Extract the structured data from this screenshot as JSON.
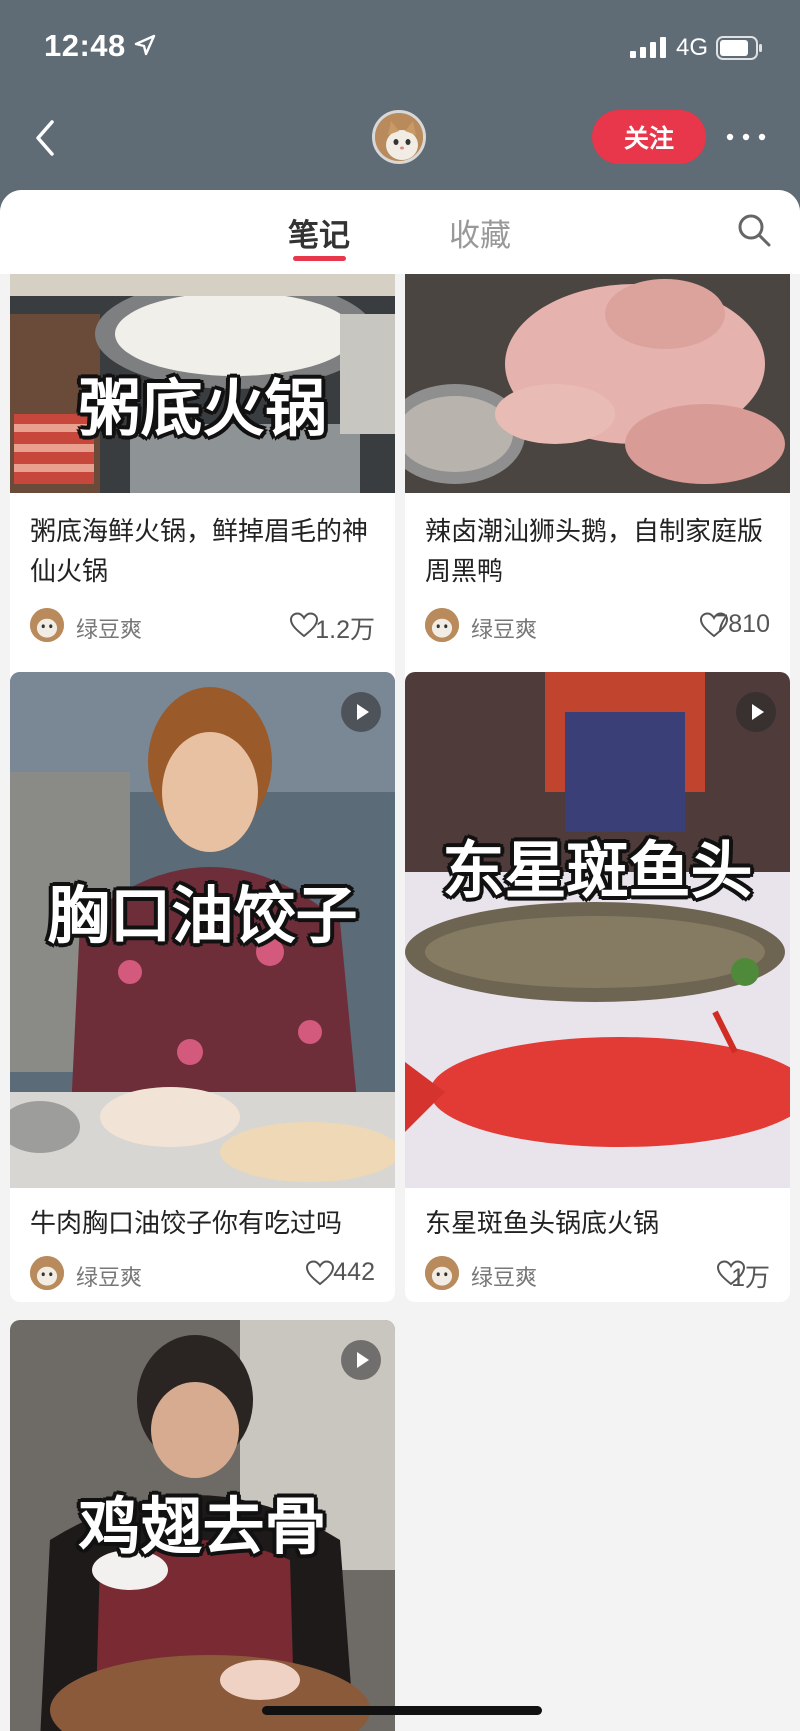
{
  "status_bar": {
    "time": "12:48",
    "network": "4G"
  },
  "header": {
    "follow_label": "关注"
  },
  "tabs": [
    {
      "label": "笔记"
    },
    {
      "label": "收藏"
    }
  ],
  "notes": [
    {
      "overlay": "粥底火锅",
      "title": "粥底海鲜火锅，鲜掉眉毛的神仙火锅",
      "author": "绿豆爽",
      "likes": "1.2万",
      "video": false
    },
    {
      "overlay": "",
      "title": "辣卤潮汕狮头鹅，自制家庭版周黑鸭",
      "author": "绿豆爽",
      "likes": "7810",
      "video": false
    },
    {
      "overlay": "胸口油饺子",
      "title": "牛肉胸口油饺子你有吃过吗",
      "author": "绿豆爽",
      "likes": "442",
      "video": true
    },
    {
      "overlay": "东星斑鱼头",
      "title": "东星斑鱼头锅底火锅",
      "author": "绿豆爽",
      "likes": "1万",
      "video": true
    },
    {
      "overlay": "鸡翅去骨",
      "title": "",
      "author": "",
      "likes": "",
      "video": true
    }
  ],
  "colors": {
    "accent": "#e8364a",
    "header_bg": "#5f6b75",
    "sheet_bg": "#f3f3f3"
  }
}
